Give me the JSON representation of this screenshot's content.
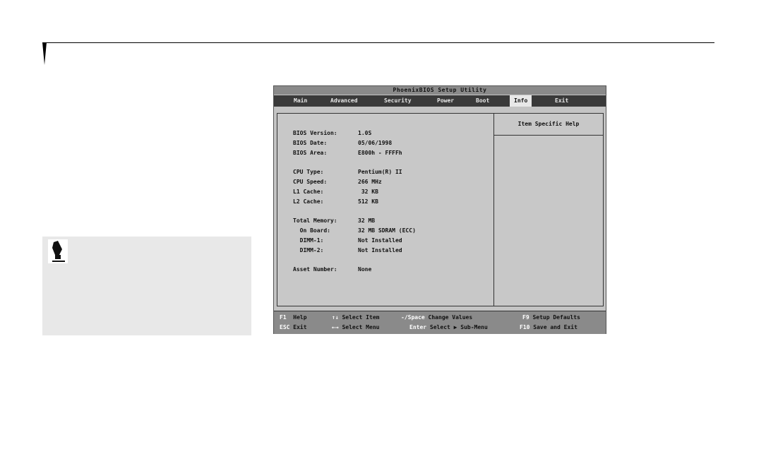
{
  "bios": {
    "title": "PhoenixBIOS Setup Utility",
    "menu": [
      {
        "label": "Main"
      },
      {
        "label": "Advanced"
      },
      {
        "label": "Security"
      },
      {
        "label": "Power"
      },
      {
        "label": "Boot"
      },
      {
        "label": "Info"
      },
      {
        "label": "Exit"
      }
    ],
    "active_menu": "Info",
    "help_title": "Item Specific Help",
    "info": [
      {
        "label": "BIOS Version:",
        "value": "1.0S"
      },
      {
        "label": "BIOS Date:",
        "value": "05/06/1998"
      },
      {
        "label": "BIOS Area:",
        "value": "E800h - FFFFh"
      },
      {
        "label": "CPU Type:",
        "value": "Pentium(R) II"
      },
      {
        "label": "CPU Speed:",
        "value": "266 MHz"
      },
      {
        "label": "L1 Cache:",
        "value": " 32 KB"
      },
      {
        "label": "L2 Cache:",
        "value": "512 KB"
      },
      {
        "label": "Total Memory:",
        "value": "32 MB"
      },
      {
        "label": "  On Board:",
        "value": "32 MB SDRAM (ECC)"
      },
      {
        "label": "  DIMM-1:",
        "value": "Not Installed"
      },
      {
        "label": "  DIMM-2:",
        "value": "Not Installed"
      },
      {
        "label": "Asset Number:",
        "value": "None"
      }
    ],
    "status": {
      "f1_key": "F1",
      "f1_desc": "Help",
      "esc_key": "ESC",
      "esc_desc": "Exit",
      "updown_key": "↑↓",
      "updown_desc": "Select Item",
      "leftright_key": "←→",
      "leftright_desc": "Select Menu",
      "change_key": "-/Space",
      "change_desc": "Change Values",
      "enter_key": "Enter",
      "enter_desc": "Select ▶ Sub-Menu",
      "f9_key": "F9",
      "f9_desc": "Setup Defaults",
      "f10_key": "F10",
      "f10_desc": "Save and Exit"
    }
  },
  "note": {
    "icon": "pointing-hand-icon"
  },
  "colors": {
    "menu_bar": "#3a3a3a",
    "screen_bg": "#c4c4c4",
    "status_bar": "#8a8a8a",
    "note_bg": "#e8e8e8"
  }
}
